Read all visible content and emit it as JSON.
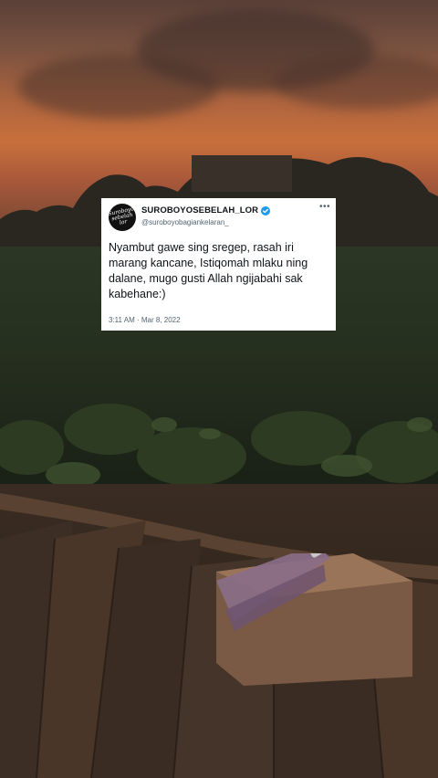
{
  "tweet": {
    "avatar_text": "Suroboyo sebelah lor",
    "display_name": "SUROBOYOSEBELAH_LOR",
    "verified": true,
    "handle": "@suroboyobagiankelaran_",
    "more_label": "•••",
    "text": "Nyambut gawe sing sregep, rasah iri marang kancane, Istiqomah mlaku ning dalane, mugo gusti Allah ngijabahi sak kabehane:)",
    "timestamp": "3:11 AM · Mar 8, 2022"
  },
  "colors": {
    "verified": "#1d9bf0",
    "card_bg": "#ffffff",
    "text": "#0f1419",
    "muted": "#536471"
  }
}
